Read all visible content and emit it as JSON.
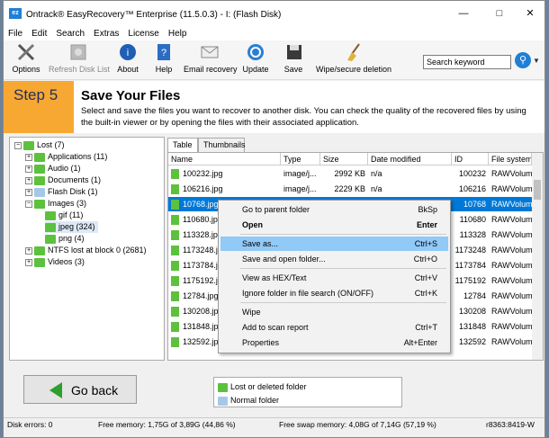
{
  "window": {
    "title": "Ontrack® EasyRecovery™ Enterprise (11.5.0.3) - I: (Flash Disk)"
  },
  "menu": [
    "File",
    "Edit",
    "Search",
    "Extras",
    "License",
    "Help"
  ],
  "toolbar": {
    "options": "Options",
    "refresh": "Refresh Disk List",
    "about": "About",
    "help": "Help",
    "email": "Email recovery",
    "update": "Update",
    "save": "Save",
    "wipe": "Wipe/secure deletion",
    "search_placeholder": "Search keyword"
  },
  "step": {
    "label": "Step 5",
    "title": "Save Your Files",
    "description": "Select and save the files you want to recover to another disk. You can check the quality of the recovered files by using the built-in viewer or by opening the files with their associated application."
  },
  "tree": [
    {
      "label": "Lost (7)"
    },
    {
      "label": "Applications (11)"
    },
    {
      "label": "Audio (1)"
    },
    {
      "label": "Documents (1)"
    },
    {
      "label": "Flash Disk (1)"
    },
    {
      "label": "Images (3)"
    },
    {
      "label": "gif (11)"
    },
    {
      "label": "jpeg (324)"
    },
    {
      "label": "png (4)"
    },
    {
      "label": "NTFS lost at block 0 (2681)"
    },
    {
      "label": "Videos (3)"
    }
  ],
  "tabs": [
    "Table",
    "Thumbnails"
  ],
  "columns": [
    "Name",
    "Type",
    "Size",
    "Date modified",
    "ID",
    "File system"
  ],
  "rows": [
    {
      "name": "100232.jpg",
      "type": "image/j...",
      "size": "2992 KB",
      "date": "n/a",
      "id": "100232",
      "fs": "RAWVolum"
    },
    {
      "name": "106216.jpg",
      "type": "image/j...",
      "size": "2229 KB",
      "date": "n/a",
      "id": "106216",
      "fs": "RAWVolum"
    },
    {
      "name": "10768.jpg",
      "type": "",
      "size": "",
      "date": "",
      "id": "10768",
      "fs": "RAWVolum"
    },
    {
      "name": "110680.jpg",
      "type": "",
      "size": "",
      "date": "",
      "id": "110680",
      "fs": "RAWVolum"
    },
    {
      "name": "113328.jpg",
      "type": "",
      "size": "",
      "date": "",
      "id": "113328",
      "fs": "RAWVolum"
    },
    {
      "name": "1173248.jpg",
      "type": "",
      "size": "",
      "date": "",
      "id": "1173248",
      "fs": "RAWVolum"
    },
    {
      "name": "1173784.jpg",
      "type": "",
      "size": "",
      "date": "",
      "id": "1173784",
      "fs": "RAWVolum"
    },
    {
      "name": "1175192.jpg",
      "type": "",
      "size": "",
      "date": "",
      "id": "1175192",
      "fs": "RAWVolum"
    },
    {
      "name": "12784.jpg",
      "type": "",
      "size": "",
      "date": "",
      "id": "12784",
      "fs": "RAWVolum"
    },
    {
      "name": "130208.jpg",
      "type": "",
      "size": "",
      "date": "",
      "id": "130208",
      "fs": "RAWVolum"
    },
    {
      "name": "131848.jpg",
      "type": "",
      "size": "",
      "date": "",
      "id": "131848",
      "fs": "RAWVolum"
    },
    {
      "name": "132592.jpg",
      "type": "",
      "size": "",
      "date": "",
      "id": "132592",
      "fs": "RAWVolum"
    }
  ],
  "context_menu": [
    {
      "label": "Go to parent folder",
      "shortcut": "BkSp"
    },
    {
      "label": "Open",
      "shortcut": "Enter"
    },
    {
      "label": "Save as...",
      "shortcut": "Ctrl+S"
    },
    {
      "label": "Save and open folder...",
      "shortcut": "Ctrl+O"
    },
    {
      "label": "View as HEX/Text",
      "shortcut": "Ctrl+V"
    },
    {
      "label": "Ignore folder in file search (ON/OFF)",
      "shortcut": "Ctrl+K"
    },
    {
      "label": "Wipe",
      "shortcut": ""
    },
    {
      "label": "Add to scan report",
      "shortcut": "Ctrl+T"
    },
    {
      "label": "Properties",
      "shortcut": "Alt+Enter"
    }
  ],
  "bottom": {
    "go_back": "Go back",
    "legend_lost": "Lost or deleted folder",
    "legend_normal": "Normal folder"
  },
  "status": {
    "errors": "Disk errors: 0",
    "memory": "Free memory: 1,75G of 3,89G (44,86 %)",
    "swap": "Free swap memory: 4,08G of 7,14G (57,19 %)",
    "build": "r8363:8419-W"
  }
}
